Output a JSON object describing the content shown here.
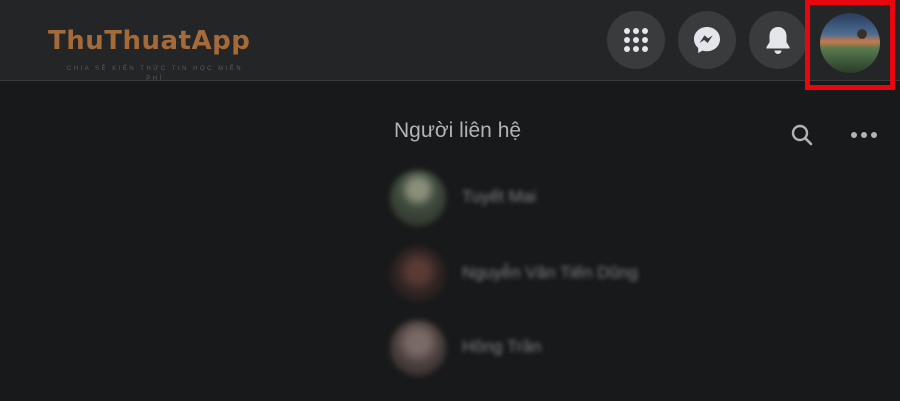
{
  "header": {
    "logo_text": "ThuThuatApp",
    "logo_tagline": "CHIA SẺ KIẾN THỨC TIN HỌC MIỄN PHÍ",
    "menu_icon": "grid-menu-icon",
    "messenger_icon": "messenger-icon",
    "notifications_icon": "bell-icon",
    "highlight_color": "#e8060f"
  },
  "contacts_panel": {
    "title": "Người liên hệ",
    "search_icon": "search-icon",
    "more_icon": "more-options-icon",
    "items": [
      {
        "name": "Tuyết Mai"
      },
      {
        "name": "Nguyễn Văn Tiến Dũng"
      },
      {
        "name": "Hồng Trần"
      }
    ]
  }
}
